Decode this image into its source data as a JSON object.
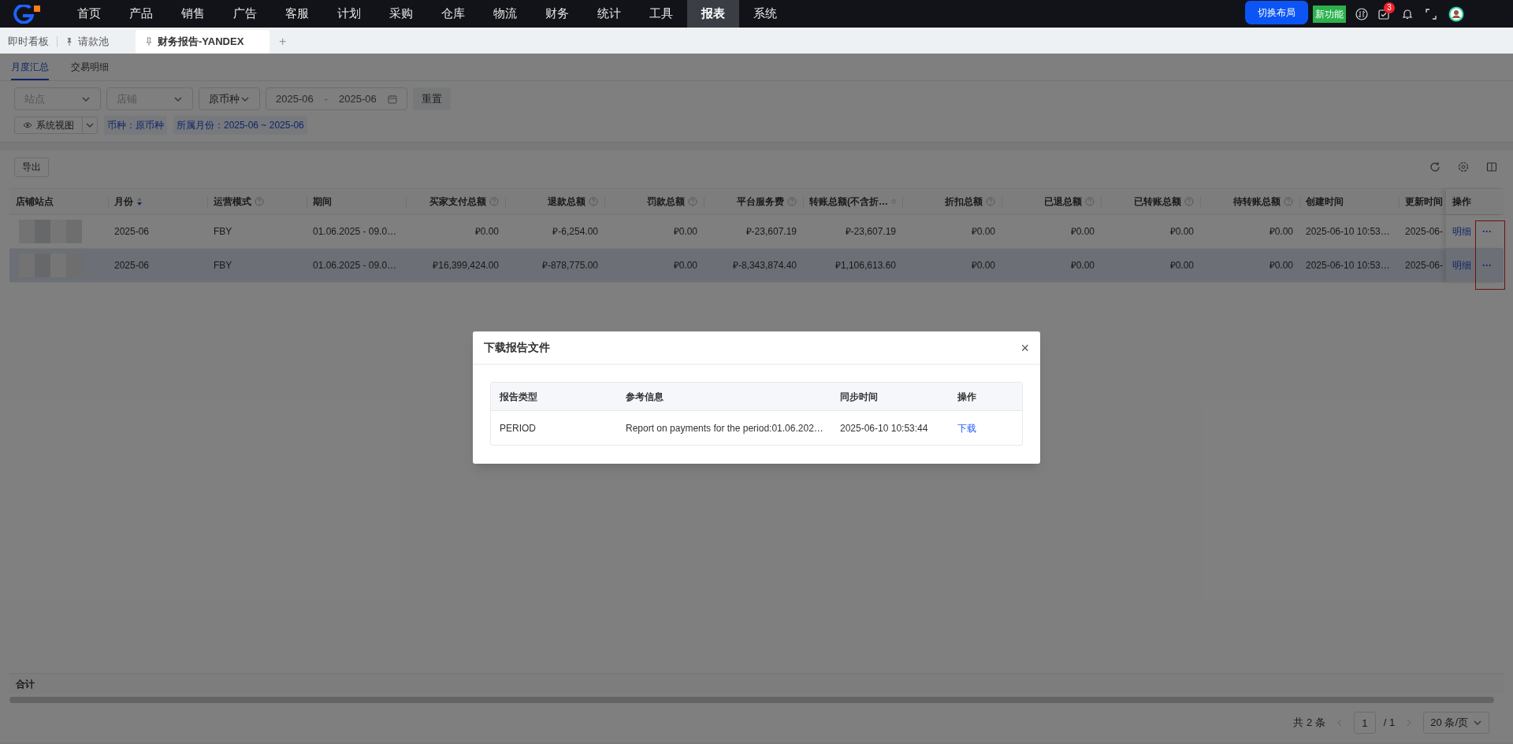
{
  "nav": {
    "items": [
      {
        "label": "首页",
        "selected": false
      },
      {
        "label": "产品",
        "selected": false
      },
      {
        "label": "销售",
        "selected": false
      },
      {
        "label": "广告",
        "selected": false
      },
      {
        "label": "客服",
        "selected": false
      },
      {
        "label": "计划",
        "selected": false
      },
      {
        "label": "采购",
        "selected": false
      },
      {
        "label": "仓库",
        "selected": false
      },
      {
        "label": "物流",
        "selected": false
      },
      {
        "label": "财务",
        "selected": false
      },
      {
        "label": "统计",
        "selected": false
      },
      {
        "label": "工具",
        "selected": false
      },
      {
        "label": "报表",
        "selected": true
      },
      {
        "label": "系统",
        "selected": false
      }
    ],
    "switch_layout": "切换布局",
    "new_feature": "新功能",
    "task_badge": "3"
  },
  "tabs": [
    {
      "label": "即时看板",
      "pinned": false,
      "selected": false
    },
    {
      "label": "请款池",
      "pinned": true,
      "selected": false
    },
    {
      "label": "财务报告-YANDEX",
      "pinned": true,
      "selected": true
    }
  ],
  "add_tab": "+",
  "sub_tabs": [
    {
      "label": "月度汇总",
      "selected": true
    },
    {
      "label": "交易明细",
      "selected": false
    }
  ],
  "filters": {
    "site": {
      "placeholder": "站点"
    },
    "store": {
      "placeholder": "店铺"
    },
    "currency": {
      "value": "原币种"
    },
    "month_range": {
      "from": "2025-06",
      "separator": "-",
      "to": "2025-06"
    },
    "reset": "重置",
    "view": "系统视图",
    "tags": [
      "币种：原币种",
      "所属月份：2025-06 ~ 2025-06"
    ]
  },
  "toolbar": {
    "export": "导出"
  },
  "table": {
    "columns": [
      {
        "label": "店铺站点",
        "kind": "text",
        "help": false,
        "sortable": false
      },
      {
        "label": "月份",
        "kind": "text",
        "help": false,
        "sortable": true
      },
      {
        "label": "运营模式",
        "kind": "text",
        "help": true,
        "sortable": false
      },
      {
        "label": "期间",
        "kind": "text",
        "help": false,
        "sortable": false
      },
      {
        "label": "买家支付总额",
        "kind": "amount",
        "help": true,
        "sortable": false
      },
      {
        "label": "退款总额",
        "kind": "amount",
        "help": true,
        "sortable": false
      },
      {
        "label": "罚款总额",
        "kind": "amount",
        "help": true,
        "sortable": false
      },
      {
        "label": "平台服务费",
        "kind": "amount",
        "help": true,
        "sortable": false
      },
      {
        "label": "转账总额(不含折…",
        "kind": "amount",
        "help": true,
        "sortable": false
      },
      {
        "label": "折扣总额",
        "kind": "amount",
        "help": true,
        "sortable": false
      },
      {
        "label": "已退总额",
        "kind": "amount",
        "help": true,
        "sortable": false
      },
      {
        "label": "已转账总额",
        "kind": "amount",
        "help": true,
        "sortable": false
      },
      {
        "label": "待转账总额",
        "kind": "amount",
        "help": true,
        "sortable": false
      },
      {
        "label": "创建时间",
        "kind": "text",
        "help": false,
        "sortable": false
      },
      {
        "label": "更新时间",
        "kind": "text",
        "help": false,
        "sortable": false
      },
      {
        "label": "操作",
        "kind": "text",
        "help": false,
        "sortable": false
      }
    ],
    "rows": [
      {
        "hovered": false,
        "cells": [
          "",
          "2025-06",
          "FBY",
          "01.06.2025 - 09.0…",
          "₽0.00",
          "₽-6,254.00",
          "₽0.00",
          "₽-23,607.19",
          "₽-23,607.19",
          "₽0.00",
          "₽0.00",
          "₽0.00",
          "₽0.00",
          "2025-06-10 10:53…",
          "2025-06-"
        ],
        "actions": [
          "明细",
          "···"
        ]
      },
      {
        "hovered": true,
        "cells": [
          "",
          "2025-06",
          "FBY",
          "01.06.2025 - 09.0…",
          "₽16,399,424.00",
          "₽-878,775.00",
          "₽0.00",
          "₽-8,343,874.40",
          "₽1,106,613.60",
          "₽0.00",
          "₽0.00",
          "₽0.00",
          "₽0.00",
          "2025-06-10 10:53…",
          "2025-06-"
        ],
        "actions": [
          "明细",
          "···"
        ]
      }
    ],
    "more_actions_highlighted": true,
    "total_label": "合计"
  },
  "pagination": {
    "total": "共 2 条",
    "page": "1",
    "pages": "/ 1",
    "page_size": "20 条/页"
  },
  "modal": {
    "title": "下载报告文件",
    "close": "×",
    "columns": [
      "报告类型",
      "参考信息",
      "同步时间",
      "操作"
    ],
    "rows": [
      {
        "type": "PERIOD",
        "info": "Report on payments for the period:01.06.202…",
        "sync_time": "2025-06-10 10:53:44",
        "action": "下载"
      }
    ]
  }
}
